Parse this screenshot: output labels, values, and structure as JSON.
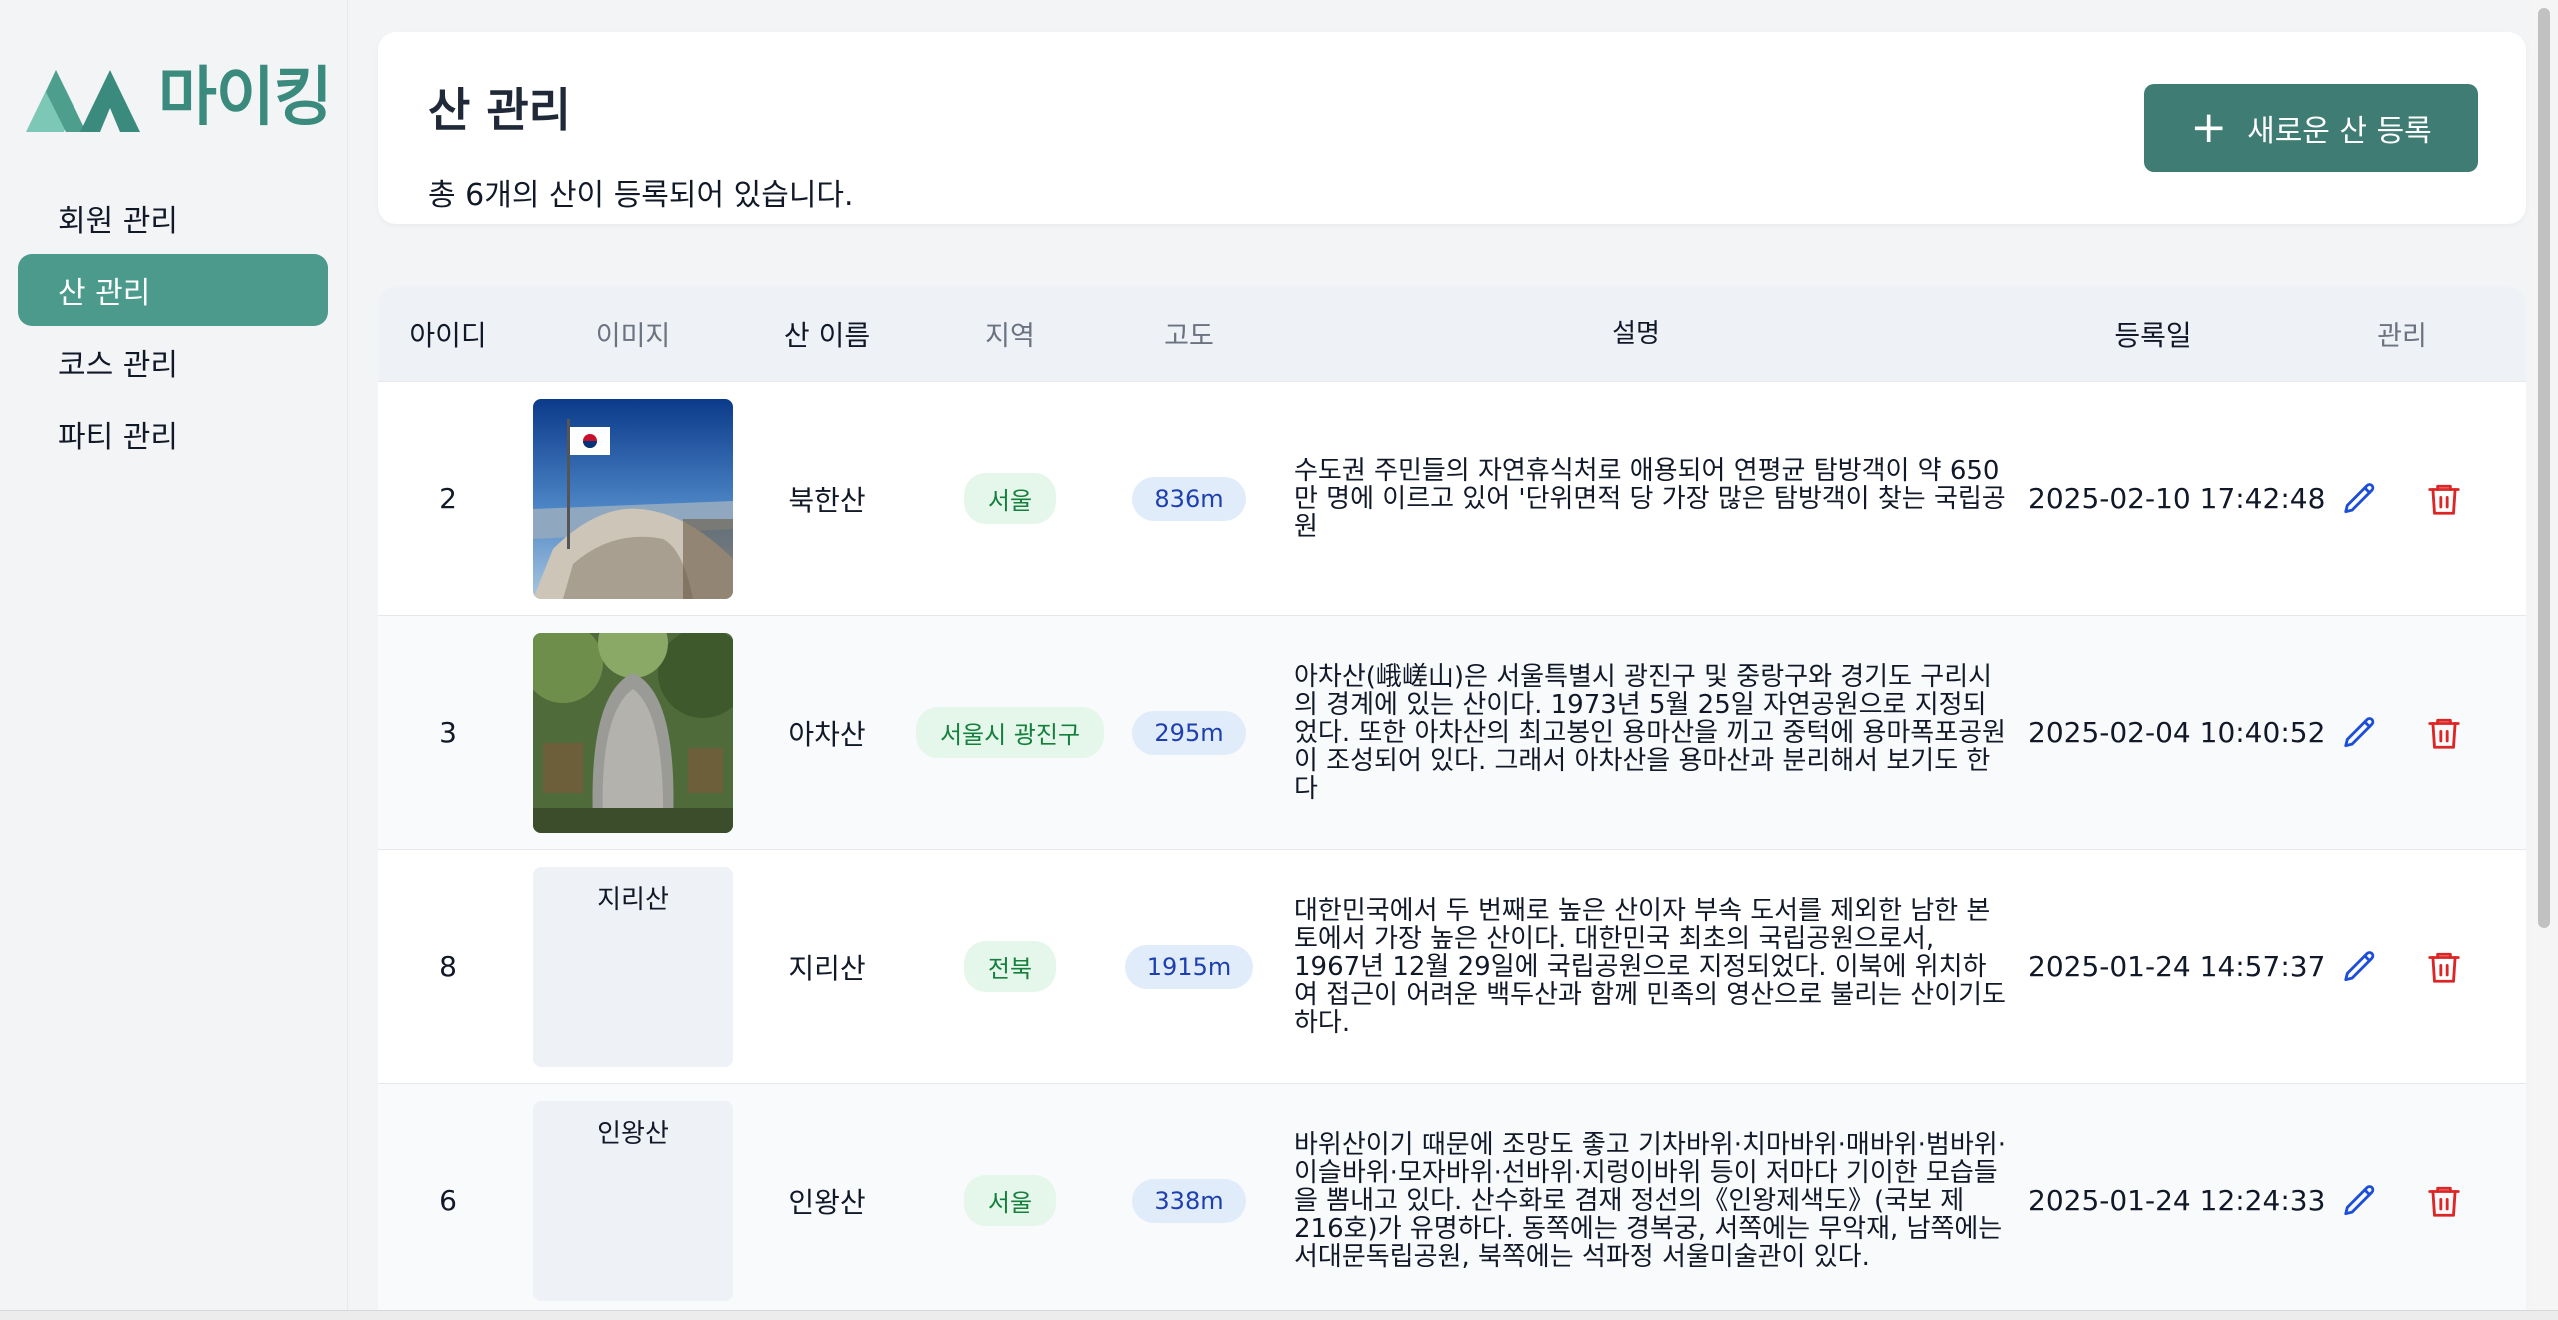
{
  "brand": {
    "name": "마이킹",
    "color": "#3a8a7d"
  },
  "sidebar": {
    "items": [
      {
        "label": "회원 관리",
        "active": false
      },
      {
        "label": "산 관리",
        "active": true
      },
      {
        "label": "코스 관리",
        "active": false
      },
      {
        "label": "파티 관리",
        "active": false
      }
    ]
  },
  "header": {
    "title": "산 관리",
    "subtitle": "총 6개의 산이 등록되어 있습니다.",
    "add_button": "새로운 산 등록",
    "add_icon": "+"
  },
  "table": {
    "columns": [
      "아이디",
      "이미지",
      "산 이름",
      "지역",
      "고도",
      "설명",
      "등록일",
      "관리"
    ],
    "rows": [
      {
        "id": "2",
        "image": "korea-flag-summit-photo",
        "image_alt": "",
        "name": "북한산",
        "region": "서울",
        "altitude": "836m",
        "description": "수도권 주민들의 자연휴식처로 애용되어 연평균 탐방객이 약 650만 명에 이르고 있어 '단위면적 당 가장 많은 탐방객이 찾는 국립공원",
        "date": "2025-02-10 17:42:48"
      },
      {
        "id": "3",
        "image": "achasan-stone-monument-photo",
        "image_alt": "",
        "name": "아차산",
        "region": "서울시 광진구",
        "altitude": "295m",
        "description": "아차산(峨嵯山)은 서울특별시 광진구 및 중랑구와 경기도 구리시의 경계에 있는 산이다. 1973년 5월 25일 자연공원으로 지정되었다. 또한 아차산의 최고봉인 용마산을 끼고 중턱에 용마폭포공원이 조성되어 있다. 그래서 아차산을 용마산과 분리해서 보기도 한다",
        "date": "2025-02-04 10:40:52"
      },
      {
        "id": "8",
        "image": "broken-image",
        "image_alt": "지리산",
        "name": "지리산",
        "region": "전북",
        "altitude": "1915m",
        "description": "대한민국에서 두 번째로 높은 산이자 부속 도서를 제외한 남한 본토에서 가장 높은 산이다. 대한민국 최초의 국립공원으로서, 1967년 12월 29일에 국립공원으로 지정되었다. 이북에 위치하여 접근이 어려운 백두산과 함께 민족의 영산으로 불리는 산이기도 하다.",
        "date": "2025-01-24 14:57:37"
      },
      {
        "id": "6",
        "image": "broken-image",
        "image_alt": "인왕산",
        "name": "인왕산",
        "region": "서울",
        "altitude": "338m",
        "description": "바위산이기 때문에 조망도 좋고 기차바위·치마바위·매바위·범바위·이슬바위·모자바위·선바위·지렁이바위 등이 저마다 기이한 모습들을 뽐내고 있다. 산수화로 겸재 정선의《인왕제색도》(국보 제216호)가 유명하다. 동쪽에는 경복궁, 서쪽에는 무악재, 남쪽에는 서대문독립공원, 북쪽에는 석파정 서울미술관이 있다.",
        "date": "2025-01-24 12:24:33"
      }
    ],
    "actions": {
      "edit_icon": "pencil-icon",
      "delete_icon": "trash-icon"
    }
  },
  "colors": {
    "accent": "#3f7c73",
    "active_nav": "#4b9a8b",
    "region_badge": "#e5f6ea",
    "altitude_badge": "#e1ecfb",
    "edit": "#1d4ed8",
    "delete": "#dc2626"
  }
}
